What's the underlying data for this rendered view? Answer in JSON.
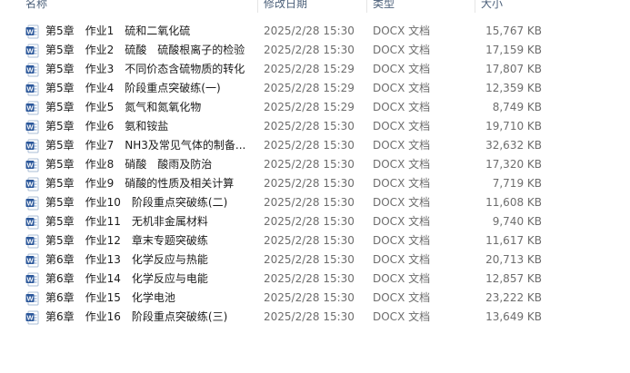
{
  "columns": {
    "name": "名称",
    "date": "修改日期",
    "type": "类型",
    "size": "大小"
  },
  "files": [
    {
      "name": "第5章　作业1　硫和二氧化硫",
      "date": "2025/2/28 15:30",
      "type": "DOCX 文档",
      "size": "15,767 KB",
      "icon": "word-doc-icon"
    },
    {
      "name": "第5章　作业2　硫酸　硫酸根离子的检验",
      "date": "2025/2/28 15:30",
      "type": "DOCX 文档",
      "size": "17,159 KB",
      "icon": "word-doc-icon"
    },
    {
      "name": "第5章　作业3　不同价态含硫物质的转化",
      "date": "2025/2/28 15:29",
      "type": "DOCX 文档",
      "size": "17,807 KB",
      "icon": "word-doc-icon"
    },
    {
      "name": "第5章　作业4　阶段重点突破练(一)",
      "date": "2025/2/28 15:29",
      "type": "DOCX 文档",
      "size": "12,359 KB",
      "icon": "word-doc-icon"
    },
    {
      "name": "第5章　作业5　氮气和氮氧化物",
      "date": "2025/2/28 15:29",
      "type": "DOCX 文档",
      "size": "8,749 KB",
      "icon": "word-doc-icon"
    },
    {
      "name": "第5章　作业6　氨和铵盐",
      "date": "2025/2/28 15:30",
      "type": "DOCX 文档",
      "size": "19,710 KB",
      "icon": "word-doc-icon"
    },
    {
      "name": "第5章　作业7　NH3及常见气体的制备...",
      "date": "2025/2/28 15:30",
      "type": "DOCX 文档",
      "size": "32,632 KB",
      "icon": "word-doc-icon"
    },
    {
      "name": "第5章　作业8　硝酸　酸雨及防治",
      "date": "2025/2/28 15:30",
      "type": "DOCX 文档",
      "size": "17,320 KB",
      "icon": "word-doc-icon"
    },
    {
      "name": "第5章　作业9　硝酸的性质及相关计算",
      "date": "2025/2/28 15:30",
      "type": "DOCX 文档",
      "size": "7,719 KB",
      "icon": "word-doc-icon"
    },
    {
      "name": "第5章　作业10　阶段重点突破练(二)",
      "date": "2025/2/28 15:30",
      "type": "DOCX 文档",
      "size": "11,608 KB",
      "icon": "word-doc-icon"
    },
    {
      "name": "第5章　作业11　无机非金属材料",
      "date": "2025/2/28 15:30",
      "type": "DOCX 文档",
      "size": "9,740 KB",
      "icon": "word-doc-icon"
    },
    {
      "name": "第5章　作业12　章末专题突破练",
      "date": "2025/2/28 15:30",
      "type": "DOCX 文档",
      "size": "11,617 KB",
      "icon": "word-doc-icon"
    },
    {
      "name": "第6章　作业13　化学反应与热能",
      "date": "2025/2/28 15:30",
      "type": "DOCX 文档",
      "size": "20,713 KB",
      "icon": "word-doc-icon"
    },
    {
      "name": "第6章　作业14　化学反应与电能",
      "date": "2025/2/28 15:30",
      "type": "DOCX 文档",
      "size": "12,857 KB",
      "icon": "word-doc-icon"
    },
    {
      "name": "第6章　作业15　化学电池",
      "date": "2025/2/28 15:30",
      "type": "DOCX 文档",
      "size": "23,222 KB",
      "icon": "word-doc-icon"
    },
    {
      "name": "第6章　作业16　阶段重点突破练(三)",
      "date": "2025/2/28 15:30",
      "type": "DOCX 文档",
      "size": "13,649 KB",
      "icon": "word-doc-icon"
    }
  ],
  "colors": {
    "header_text": "#4c607a",
    "word_blue": "#2b579a",
    "secondary_text": "#6d6d6d"
  }
}
